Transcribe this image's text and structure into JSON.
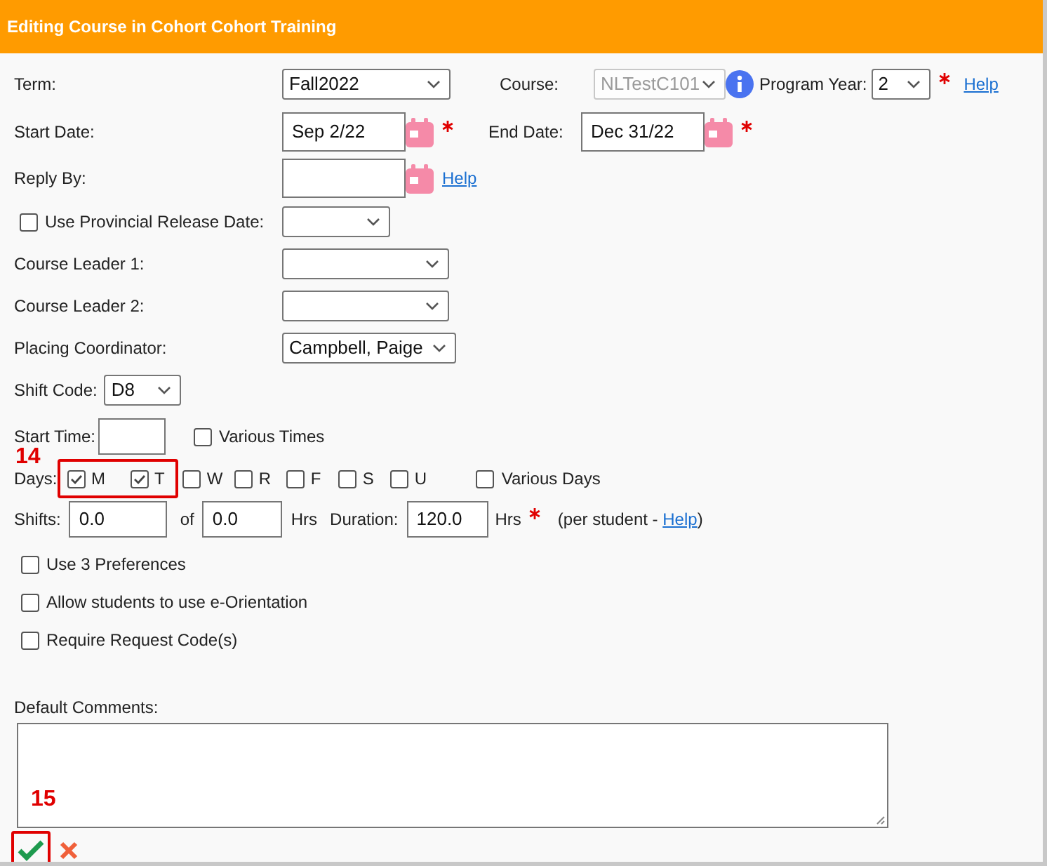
{
  "header": {
    "title": "Editing Course in Cohort Cohort Training"
  },
  "term": {
    "label": "Term:",
    "value": "Fall2022"
  },
  "course": {
    "label": "Course:",
    "value": "NLTestC101",
    "disabled": true
  },
  "program_year": {
    "label": "Program Year:",
    "value": "2",
    "required": true,
    "help": "Help"
  },
  "start_date": {
    "label": "Start Date:",
    "value": "Sep 2/22",
    "required": true
  },
  "end_date": {
    "label": "End Date:",
    "value": "Dec 31/22",
    "required": true
  },
  "reply_by": {
    "label": "Reply By:",
    "help": "Help"
  },
  "provincial_release": {
    "label": "Use Provincial Release Date:",
    "checked": false
  },
  "course_leader_1": {
    "label": "Course Leader 1:"
  },
  "course_leader_2": {
    "label": "Course Leader 2:"
  },
  "placing_coordinator": {
    "label": "Placing Coordinator:",
    "value": "Campbell, Paige"
  },
  "shift_code": {
    "label": "Shift Code:",
    "value": "D8"
  },
  "start_time": {
    "label": "Start Time:",
    "various": {
      "label": "Various Times",
      "checked": false
    }
  },
  "days": {
    "label": "Days:",
    "annotation": "14",
    "items": [
      {
        "label": "M",
        "checked": true,
        "highlighted": true
      },
      {
        "label": "T",
        "checked": true,
        "highlighted": true
      },
      {
        "label": "W",
        "checked": false,
        "highlighted": false
      },
      {
        "label": "R",
        "checked": false,
        "highlighted": false
      },
      {
        "label": "F",
        "checked": false,
        "highlighted": false
      },
      {
        "label": "S",
        "checked": false,
        "highlighted": false
      },
      {
        "label": "U",
        "checked": false,
        "highlighted": false
      }
    ],
    "various": {
      "label": "Various Days",
      "checked": false
    }
  },
  "shifts": {
    "label": "Shifts:",
    "value": "0.0",
    "of_label": "of",
    "of_value": "0.0",
    "hrs_label": "Hrs",
    "duration_label": "Duration:",
    "duration_value": "120.0",
    "duration_unit": "Hrs",
    "required": true,
    "note_prefix": "(per student - ",
    "note_link": "Help",
    "note_suffix": ")"
  },
  "options": [
    {
      "label": "Use 3 Preferences",
      "checked": false
    },
    {
      "label": "Allow students to use e-Orientation",
      "checked": false
    },
    {
      "label": "Require Request Code(s)",
      "checked": false
    }
  ],
  "default_comments": {
    "label": "Default Comments:"
  },
  "actions": {
    "annotation": "15"
  }
}
